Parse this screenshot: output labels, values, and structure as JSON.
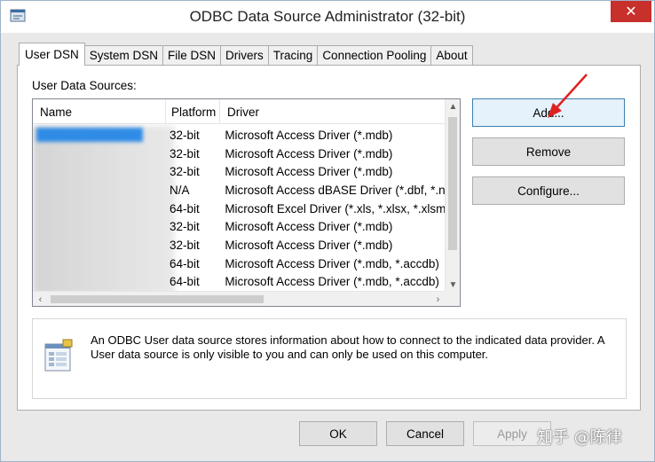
{
  "window": {
    "title": "ODBC Data Source Administrator (32-bit)",
    "close_glyph": "✕"
  },
  "tabs": [
    {
      "label": "User DSN",
      "active": true
    },
    {
      "label": "System DSN"
    },
    {
      "label": "File DSN"
    },
    {
      "label": "Drivers"
    },
    {
      "label": "Tracing"
    },
    {
      "label": "Connection Pooling"
    },
    {
      "label": "About"
    }
  ],
  "user_dsn": {
    "section_label": "User Data Sources:",
    "columns": {
      "name": "Name",
      "platform": "Platform",
      "driver": "Driver"
    },
    "rows": [
      {
        "platform": "32-bit",
        "driver": "Microsoft Access Driver (*.mdb)"
      },
      {
        "platform": "32-bit",
        "driver": "Microsoft Access Driver (*.mdb)"
      },
      {
        "platform": "32-bit",
        "driver": "Microsoft Access Driver (*.mdb)"
      },
      {
        "platform": "N/A",
        "driver": "Microsoft Access dBASE Driver (*.dbf, *.nd"
      },
      {
        "platform": "64-bit",
        "driver": "Microsoft Excel Driver (*.xls, *.xlsx, *.xlsm, *"
      },
      {
        "platform": "32-bit",
        "driver": "Microsoft Access Driver (*.mdb)"
      },
      {
        "platform": "32-bit",
        "driver": "Microsoft Access Driver (*.mdb)"
      },
      {
        "platform": "64-bit",
        "driver": "Microsoft Access Driver (*.mdb, *.accdb)"
      },
      {
        "platform": "64-bit",
        "driver": "Microsoft Access Driver (*.mdb, *.accdb)"
      }
    ],
    "buttons": {
      "add": "Add...",
      "remove": "Remove",
      "configure": "Configure..."
    },
    "info_text": "An ODBC User data source stores information about how to connect to the indicated data provider.  A User data source is only visible to you and can only be used on this computer."
  },
  "footer": {
    "ok": "OK",
    "cancel": "Cancel",
    "apply": "Apply"
  },
  "watermark": "知乎 @陈律",
  "colors": {
    "selection": "#2e8be6",
    "annotation_arrow": "#e02020",
    "close_button": "#c7302b"
  }
}
